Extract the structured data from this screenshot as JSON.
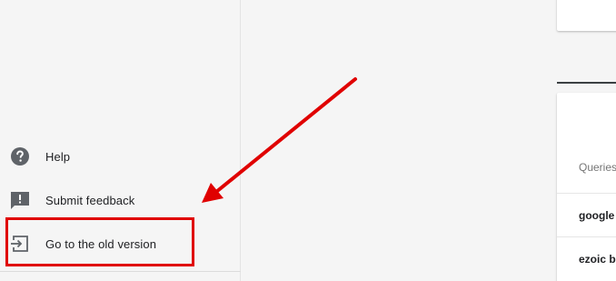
{
  "sidebar": {
    "items": [
      {
        "label": "Help",
        "icon": "help-circle-icon"
      },
      {
        "label": "Submit feedback",
        "icon": "feedback-icon"
      },
      {
        "label": "Go to the old version",
        "icon": "exit-to-app-icon"
      }
    ]
  },
  "queries_card": {
    "header": "Queries",
    "rows": [
      "google",
      "ezoic b"
    ]
  },
  "annotation": {
    "color": "#e00000"
  },
  "colors": {
    "icon_gray": "#5f6368",
    "text_dark": "#202124",
    "background": "#f5f5f5"
  }
}
